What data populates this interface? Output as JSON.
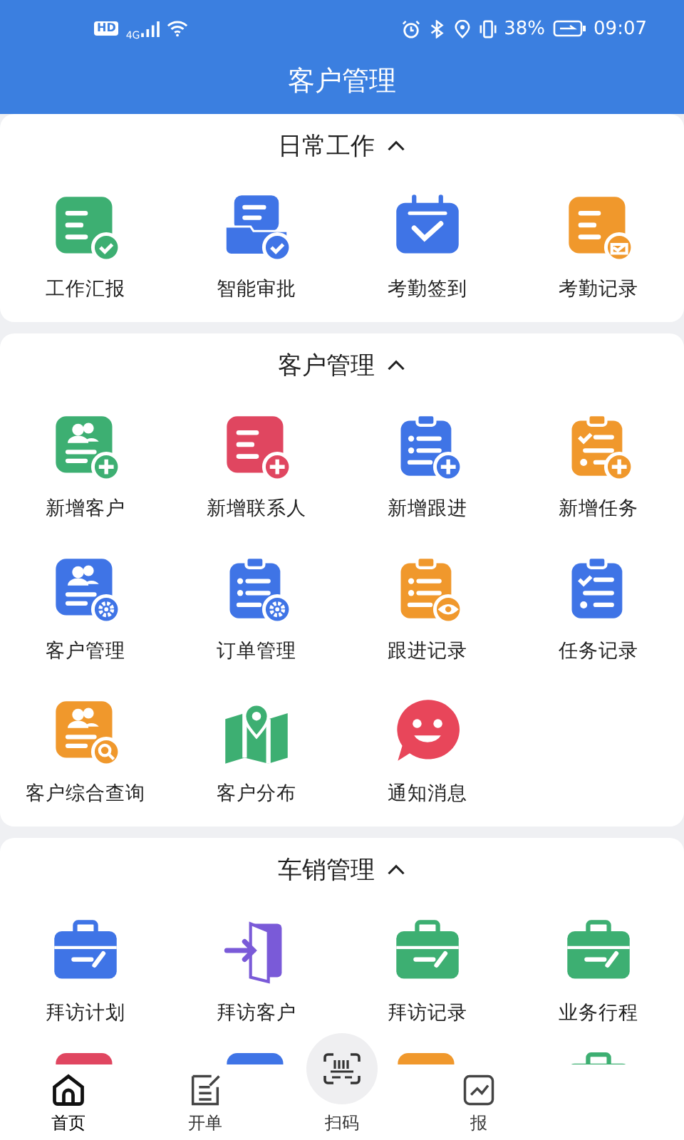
{
  "status_bar": {
    "network_badges": [
      "HD",
      "4G"
    ],
    "battery": "38%",
    "time": "09:07"
  },
  "header": {
    "title": "客户管理"
  },
  "sections": [
    {
      "title": "日常工作",
      "expanded": true,
      "items": [
        {
          "label": "工作汇报",
          "color": "#3daf72"
        },
        {
          "label": "智能审批",
          "color": "#3f74e6"
        },
        {
          "label": "考勤签到",
          "color": "#3f74e6"
        },
        {
          "label": "考勤记录",
          "color": "#f0982c"
        }
      ]
    },
    {
      "title": "客户管理",
      "expanded": true,
      "items": [
        {
          "label": "新增客户",
          "color": "#3daf72"
        },
        {
          "label": "新增联系人",
          "color": "#e04660"
        },
        {
          "label": "新增跟进",
          "color": "#3f74e6"
        },
        {
          "label": "新增任务",
          "color": "#f0982c"
        },
        {
          "label": "客户管理",
          "color": "#3f74e6"
        },
        {
          "label": "订单管理",
          "color": "#3f74e6"
        },
        {
          "label": "跟进记录",
          "color": "#f0982c"
        },
        {
          "label": "任务记录",
          "color": "#3f74e6"
        },
        {
          "label": "客户综合查询",
          "color": "#f0982c"
        },
        {
          "label": "客户分布",
          "color": "#3daf72"
        },
        {
          "label": "通知消息",
          "color": "#e8465a"
        }
      ]
    },
    {
      "title": "车销管理",
      "expanded": true,
      "items": [
        {
          "label": "拜访计划",
          "color": "#3f74e6"
        },
        {
          "label": "拜访客户",
          "color": "#7a5ad8"
        },
        {
          "label": "拜访记录",
          "color": "#3daf72"
        },
        {
          "label": "业务行程",
          "color": "#3daf72"
        },
        {
          "color": "#e04660"
        },
        {
          "color": "#3f74e6"
        },
        {
          "color": "#f0982c"
        },
        {
          "color": "#3daf72"
        }
      ]
    }
  ],
  "bottom_nav": [
    {
      "label": "首页",
      "selected": true
    },
    {
      "label": "开单",
      "selected": false
    },
    {
      "label": "扫码",
      "selected": false
    },
    {
      "label": "报",
      "selected": false
    }
  ]
}
